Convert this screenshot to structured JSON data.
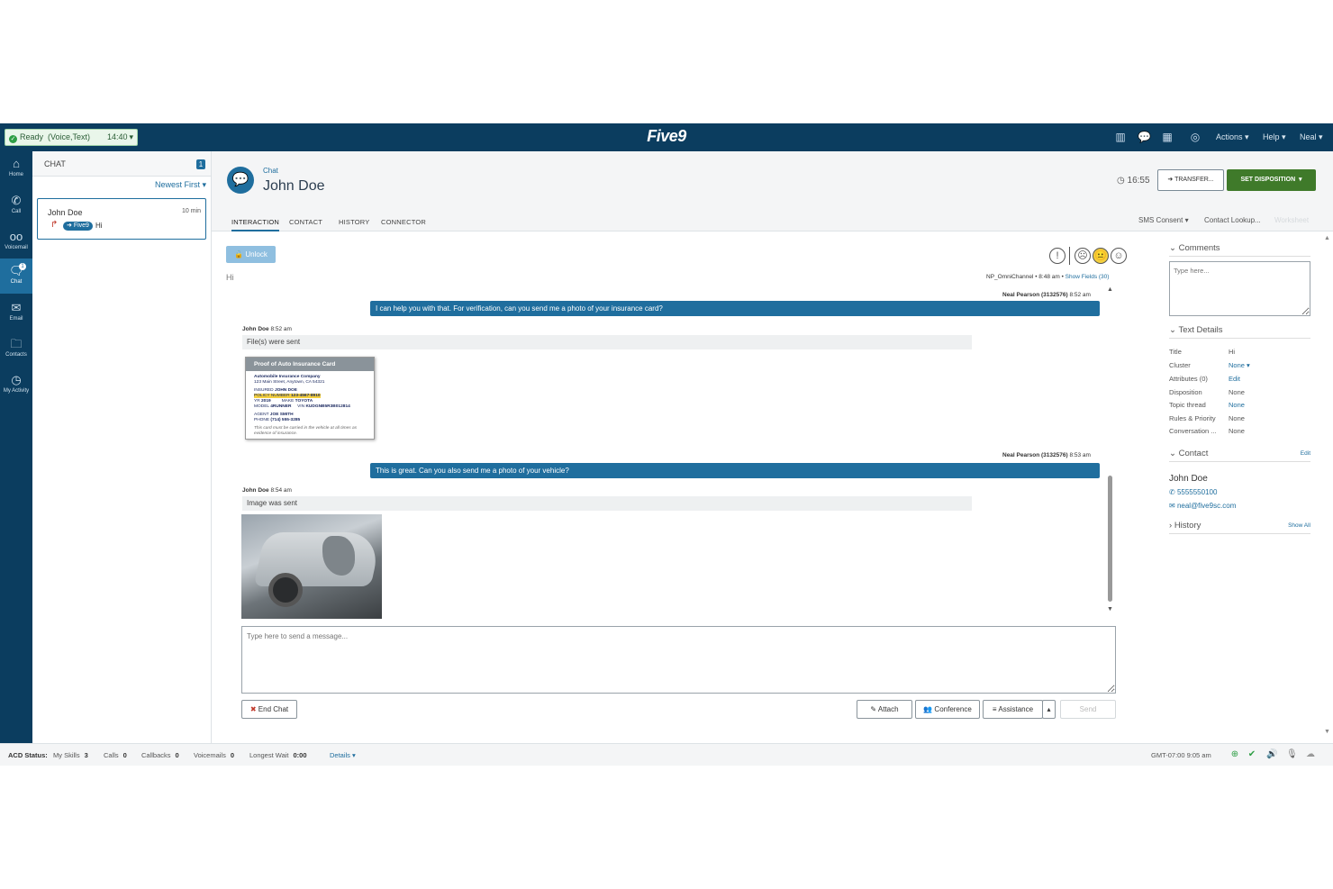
{
  "topbar": {
    "status_label": "Ready",
    "status_channels": "(Voice,Text)",
    "status_time": "14:40",
    "brand": "Five9",
    "menus": [
      "Actions",
      "Help",
      "Neal"
    ]
  },
  "leftnav": [
    {
      "label": "Home",
      "icon": "home-icon"
    },
    {
      "label": "Call",
      "icon": "phone-icon"
    },
    {
      "label": "Voicemail",
      "icon": "voicemail-icon"
    },
    {
      "label": "Chat",
      "icon": "chat-icon",
      "badge": "1"
    },
    {
      "label": "Email",
      "icon": "email-icon"
    },
    {
      "label": "Contacts",
      "icon": "folder-icon"
    },
    {
      "label": "My Activity",
      "icon": "clock-icon"
    }
  ],
  "chatlist": {
    "title": "CHAT",
    "count": "1",
    "sort": "Newest First",
    "card": {
      "name": "John Doe",
      "time": "10 min",
      "tag": "Five9",
      "message": "Hi"
    }
  },
  "main": {
    "kind": "Chat",
    "name": "John Doe",
    "timer": "16:55",
    "transfer_label": "TRANSFER...",
    "disposition_label": "SET DISPOSITION",
    "tabs": [
      "INTERACTION",
      "CONTACT",
      "HISTORY",
      "CONNECTOR"
    ],
    "right_tabs": [
      "SMS Consent",
      "Contact Lookup...",
      "Worksheet"
    ],
    "unlock_label": "Unlock",
    "first_message": "Hi",
    "channel": "NP_OmniChannel",
    "channel_time": "8:48 am",
    "show_fields": "Show Fields (30)"
  },
  "messages": {
    "m1_agent": "Neal Pearson (3132576)",
    "m1_time": "8:52 am",
    "m1_text": "I can help you with that. For verification, can you send me a photo of your insurance card?",
    "m2_customer": "John Doe",
    "m2_time": "8:52 am",
    "m2_text": "File(s) were sent",
    "m3_agent": "Neal Pearson (3132576)",
    "m3_time": "8:53 am",
    "m3_text": "This is great. Can you also send me a photo of your vehicle?",
    "m4_customer": "John Doe",
    "m4_time": "8:54 am",
    "m4_text": "Image was sent"
  },
  "insurance_card": {
    "title": "Proof of Auto Insurance Card",
    "company": "Automobile Insurance Company",
    "address": "123 Main Street, Anytown, CA 54321",
    "insured_label": "INSURED",
    "insured": "JOHN DOE",
    "policy_label": "POLICY NUMBER",
    "policy": "123-4567-8910",
    "yr_label": "YR",
    "yr": "2019",
    "make_label": "MAKE",
    "make": "TOYOTA",
    "model_label": "MODEL",
    "model": "4RUNNER",
    "vin_label": "VIN",
    "vin": "KUDGNB5R3B012814",
    "agent_label": "AGENT",
    "agent": "JOE SMITH",
    "phone_label": "PHONE",
    "phone": "(714) 555-3285",
    "footer": "This card must be carried in the vehicle at all times as evidence of insurance."
  },
  "composer": {
    "placeholder": "Type here to send a message...",
    "end_chat": "End Chat",
    "attach": "Attach",
    "conference": "Conference",
    "assistance": "Assistance",
    "send": "Send"
  },
  "right_panel": {
    "comments_title": "Comments",
    "comments_placeholder": "Type here...",
    "text_details_title": "Text Details",
    "details": [
      {
        "k": "Title",
        "v": "Hi"
      },
      {
        "k": "Cluster",
        "v": "None"
      },
      {
        "k": "Attributes (0)",
        "v": "Edit"
      },
      {
        "k": "Disposition",
        "v": "None"
      },
      {
        "k": "Topic thread",
        "v": "None"
      },
      {
        "k": "Rules & Priority",
        "v": "None"
      },
      {
        "k": "Conversation ...",
        "v": "None"
      }
    ],
    "contact_title": "Contact",
    "contact_edit": "Edit",
    "contact_name": "John Doe",
    "contact_phone": "5555550100",
    "contact_email": "neal@five9sc.com",
    "history_title": "History",
    "history_show_all": "Show All"
  },
  "bottombar": {
    "acd": "ACD Status:",
    "skills_label": "My Skills",
    "skills": "3",
    "calls_label": "Calls",
    "calls": "0",
    "callbacks_label": "Callbacks",
    "callbacks": "0",
    "voicemails_label": "Voicemails",
    "voicemails": "0",
    "longest_label": "Longest Wait",
    "longest": "0:00",
    "details": "Details",
    "clock": "GMT-07:00 9:05 am"
  },
  "colors": {
    "topbar": "#0b3d5f",
    "accent": "#1f6e9e",
    "disposition": "#3f7a2a"
  }
}
